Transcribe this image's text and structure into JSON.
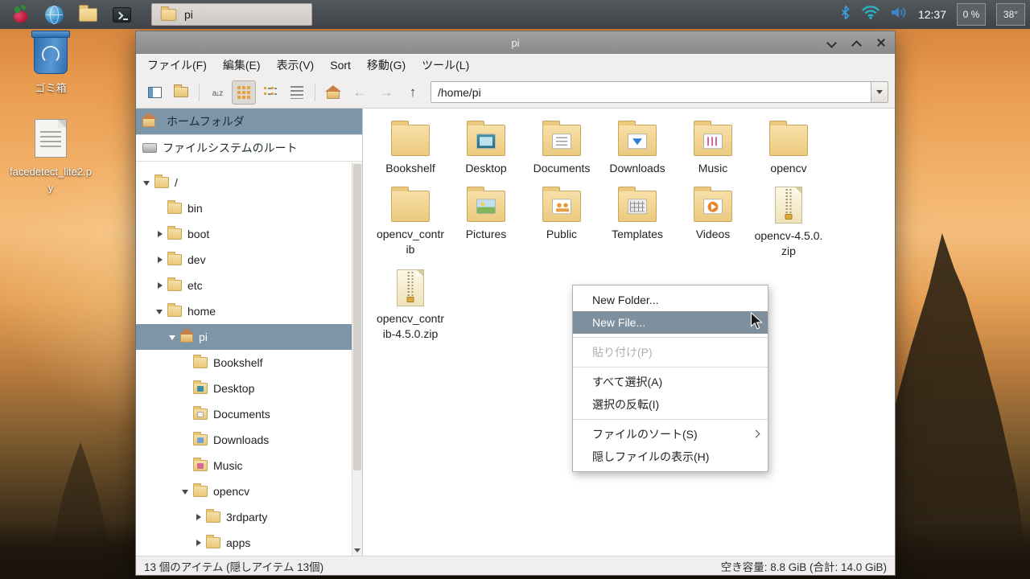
{
  "taskbar": {
    "window_button_label": "pi",
    "clock": "12:37",
    "cpu_percent": "0 %",
    "temperature": "38°"
  },
  "desktop": {
    "trash_label": "ゴミ箱",
    "file_label": "facedetect_lite2.py"
  },
  "window": {
    "title": "pi",
    "menubar": [
      "ファイル(F)",
      "編集(E)",
      "表示(V)",
      "Sort",
      "移動(G)",
      "ツール(L)"
    ],
    "toolbar": {
      "path": "/home/pi"
    },
    "sidebar": {
      "home_label": "ホームフォルダ",
      "fsroot_label": "ファイルシステムのルート",
      "tree": [
        {
          "label": "/"
        },
        {
          "label": "bin"
        },
        {
          "label": "boot"
        },
        {
          "label": "dev"
        },
        {
          "label": "etc"
        },
        {
          "label": "home"
        },
        {
          "label": "pi"
        },
        {
          "label": "Bookshelf"
        },
        {
          "label": "Desktop"
        },
        {
          "label": "Documents"
        },
        {
          "label": "Downloads"
        },
        {
          "label": "Music"
        },
        {
          "label": "opencv"
        },
        {
          "label": "3rdparty"
        },
        {
          "label": "apps"
        }
      ]
    },
    "files": [
      {
        "label": "Bookshelf"
      },
      {
        "label": "Desktop"
      },
      {
        "label": "Documents"
      },
      {
        "label": "Downloads"
      },
      {
        "label": "Music"
      },
      {
        "label": "opencv"
      },
      {
        "label": "opencv_contrib"
      },
      {
        "label": "Pictures"
      },
      {
        "label": "Public"
      },
      {
        "label": "Templates"
      },
      {
        "label": "Videos"
      },
      {
        "label": "opencv-4.5.0.zip"
      },
      {
        "label": "opencv_contrib-4.5.0.zip"
      }
    ],
    "context_menu": {
      "items": [
        {
          "label": "New Folder..."
        },
        {
          "label": "New File..."
        },
        {
          "label": "貼り付け(P)"
        },
        {
          "label": "すべて選択(A)"
        },
        {
          "label": "選択の反転(I)"
        },
        {
          "label": "ファイルのソート(S)"
        },
        {
          "label": "隠しファイルの表示(H)"
        }
      ]
    },
    "statusbar": {
      "left": "13 個のアイテム (隠しアイテム 13個)",
      "right": "空き容量: 8.8 GiB (合計: 14.0 GiB)"
    }
  },
  "colors": {
    "selection": "#7d95a9",
    "menu_highlight": "#7e909d",
    "folder": "#ecc97e",
    "taskbar": "#43484c"
  }
}
